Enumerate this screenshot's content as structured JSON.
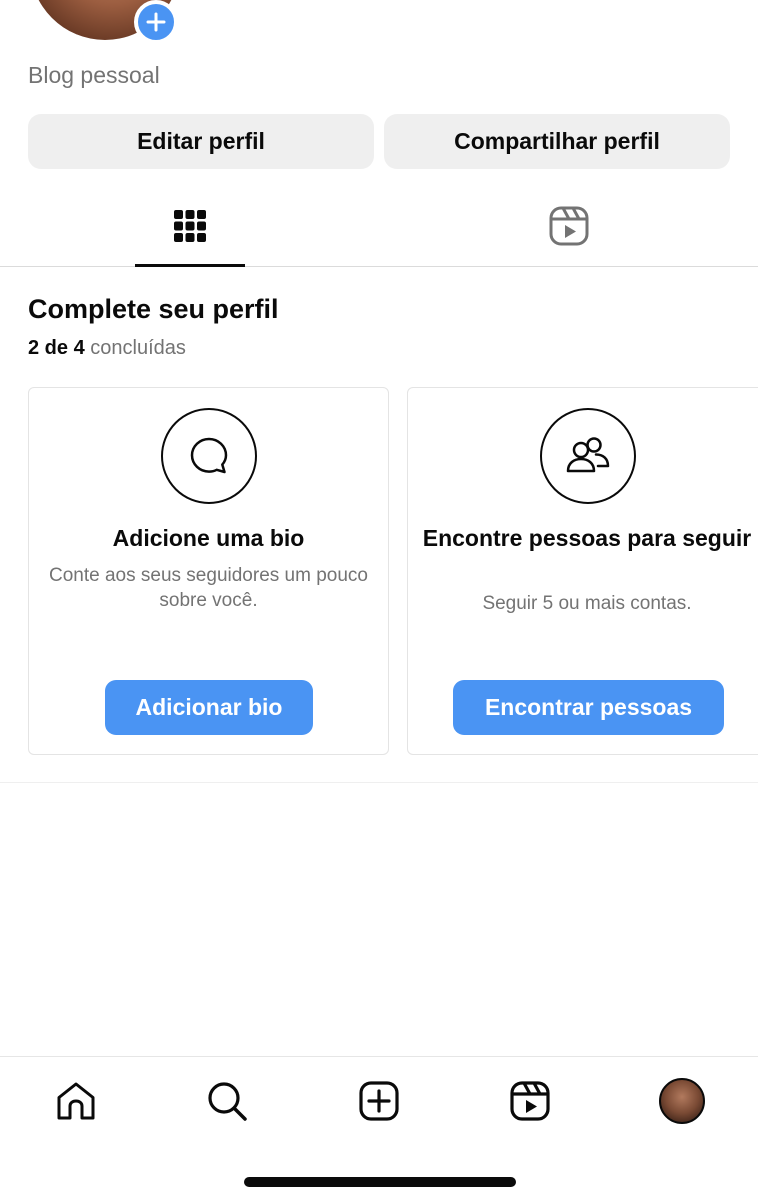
{
  "profile": {
    "bio": "Blog pessoal",
    "add_story_icon": "plus-icon"
  },
  "actions": {
    "edit_label": "Editar perfil",
    "share_label": "Compartilhar perfil"
  },
  "tabs": [
    {
      "name": "grid",
      "icon": "grid-icon",
      "active": true
    },
    {
      "name": "reels",
      "icon": "reels-icon",
      "active": false
    }
  ],
  "complete_profile": {
    "title": "Complete seu perfil",
    "progress_count": "2 de 4",
    "progress_suffix": "concluídas",
    "cards": [
      {
        "icon": "speech-bubble-icon",
        "title": "Adicione uma bio",
        "subtitle": "Conte aos seus seguidores um pouco sobre você.",
        "button": "Adicionar bio"
      },
      {
        "icon": "people-icon",
        "title": "Encontre pessoas para seguir",
        "subtitle": "Seguir 5 ou mais contas.",
        "button": "Encontrar pessoas"
      }
    ]
  },
  "bottom_nav": [
    {
      "name": "home",
      "icon": "home-icon"
    },
    {
      "name": "search",
      "icon": "search-icon"
    },
    {
      "name": "create",
      "icon": "create-icon"
    },
    {
      "name": "reels",
      "icon": "reels-icon"
    },
    {
      "name": "profile",
      "icon": "avatar"
    }
  ],
  "colors": {
    "accent": "#4a94f3",
    "button_gray": "#efefef",
    "muted_text": "#737373"
  }
}
